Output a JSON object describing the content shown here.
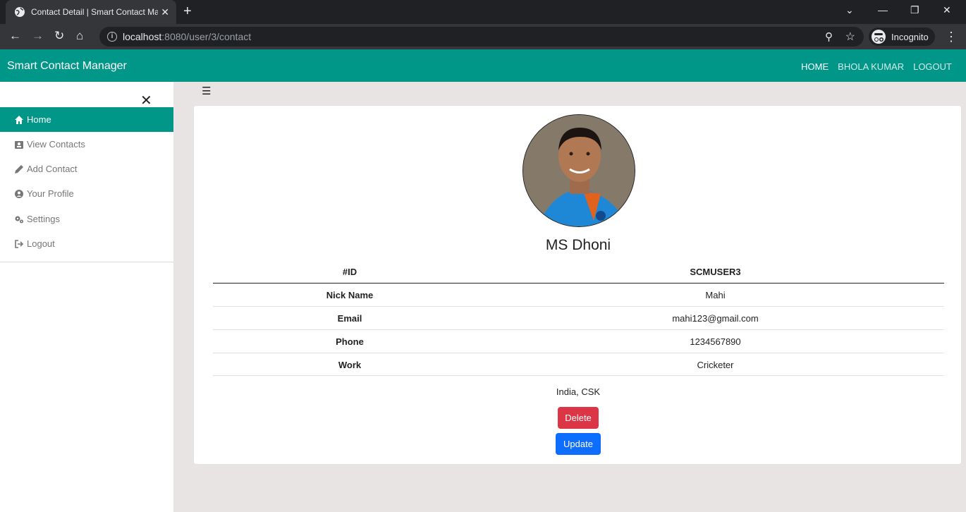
{
  "browser": {
    "tab_title": "Contact Detail | Smart Contact Manager",
    "url_host": "localhost",
    "url_path": ":8080/user/3/contact",
    "incognito_label": "Incognito"
  },
  "app": {
    "brand": "Smart Contact Manager",
    "nav": [
      "HOME",
      "BHOLA KUMAR",
      "LOGOUT"
    ],
    "accent_color": "#009688"
  },
  "sidebar": {
    "items": [
      {
        "label": "Home",
        "icon": "home-icon"
      },
      {
        "label": "View Contacts",
        "icon": "contacts-icon"
      },
      {
        "label": "Add Contact",
        "icon": "pencil-icon"
      },
      {
        "label": "Your Profile",
        "icon": "user-circle-icon"
      },
      {
        "label": "Settings",
        "icon": "gears-icon"
      },
      {
        "label": "Logout",
        "icon": "sign-out-icon"
      }
    ]
  },
  "contact": {
    "name": "MS Dhoni",
    "id_label": "#ID",
    "id_value": "SCMUSER3",
    "rows": [
      {
        "label": "Nick Name",
        "value": "Mahi"
      },
      {
        "label": "Email",
        "value": "mahi123@gmail.com"
      },
      {
        "label": "Phone",
        "value": "1234567890"
      },
      {
        "label": "Work",
        "value": "Cricketer"
      }
    ],
    "description": "India, CSK",
    "delete_label": "Delete",
    "update_label": "Update"
  }
}
